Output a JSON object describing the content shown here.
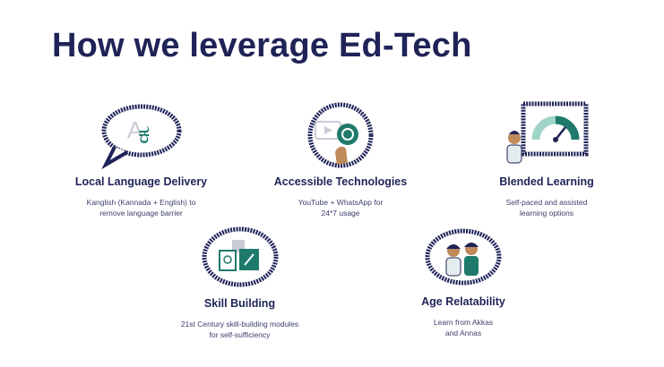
{
  "title": "How we leverage Ed-Tech",
  "features": [
    {
      "title": "Local Language Delivery",
      "desc": [
        "Kanglish (Kannada + English) to",
        "remove language barrier"
      ],
      "icon": "speech-bubble-kannada-icon"
    },
    {
      "title": "Accessible Technologies",
      "desc": [
        "YouTube + WhatsApp for",
        "24*7 usage"
      ],
      "icon": "video-whatsapp-icon"
    },
    {
      "title": "Blended Learning",
      "desc": [
        "Self-paced and assisted",
        "learning options"
      ],
      "icon": "dashboard-gauge-icon"
    },
    {
      "title": "Skill Building",
      "desc": [
        "21st Century skill-building modules",
        "for self-sufficiency"
      ],
      "icon": "skill-cards-icon"
    },
    {
      "title": "Age Relatability",
      "desc": [
        "Learn from Akkas",
        "and Annas"
      ],
      "icon": "two-students-icon"
    }
  ],
  "glyphs": {
    "latin": "A",
    "kannada": "ಕ"
  },
  "colors": {
    "navy": "#1f2357",
    "teal": "#1f7a6b",
    "skin": "#c08a5a"
  }
}
